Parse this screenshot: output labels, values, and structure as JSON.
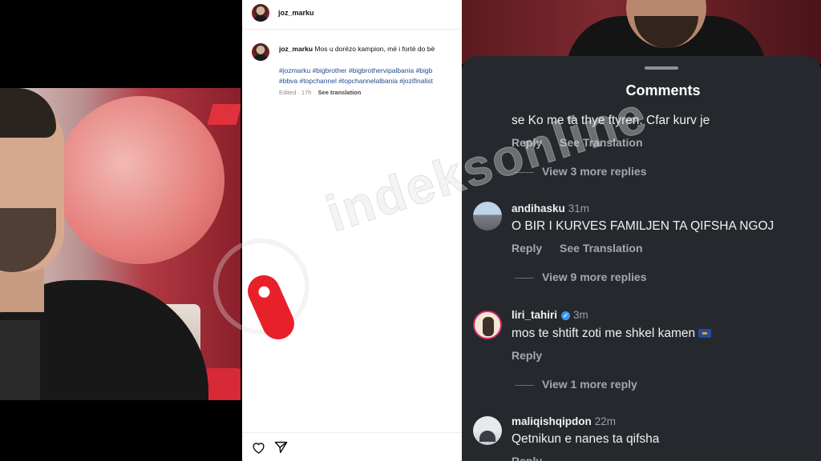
{
  "middle": {
    "header_username": "joz_marku",
    "post": {
      "username": "joz_marku",
      "caption": "Mos u dorëzo kampion, më i fortë do bë",
      "hashtags_line1": "#jozmarku #bigbrother #bigbrothervipalbania #bigb",
      "hashtags_line2": "#bbva #topchannel #topchannelalbania #jozifinalist",
      "edited": "Edited · 17h",
      "see_translation": "See translation"
    },
    "actions": {
      "like_icon": "heart-icon",
      "share_icon": "send-icon"
    }
  },
  "watermark": {
    "text": "indeksonline"
  },
  "comments": {
    "title": "Comments",
    "items": [
      {
        "text": "se Ko me ta thye ftyren. Cfar kurv je",
        "reply": "Reply",
        "translate": "See Translation",
        "more": "View 3 more replies"
      },
      {
        "username": "andihasku",
        "time": "31m",
        "text": "O BIR I KURVES FAMILJEN TA QIFSHA NGOJ",
        "reply": "Reply",
        "translate": "See Translation",
        "more": "View 9 more replies"
      },
      {
        "username": "liri_tahiri",
        "verified": true,
        "time": "3m",
        "text": "mos te shtift zoti me shkel kamen",
        "reply": "Reply",
        "more": "View 1 more reply"
      },
      {
        "username": "maliqishqipdon",
        "time": "22m",
        "text": "Qetnikun e nanes ta qifsha",
        "reply": "Reply"
      }
    ]
  }
}
